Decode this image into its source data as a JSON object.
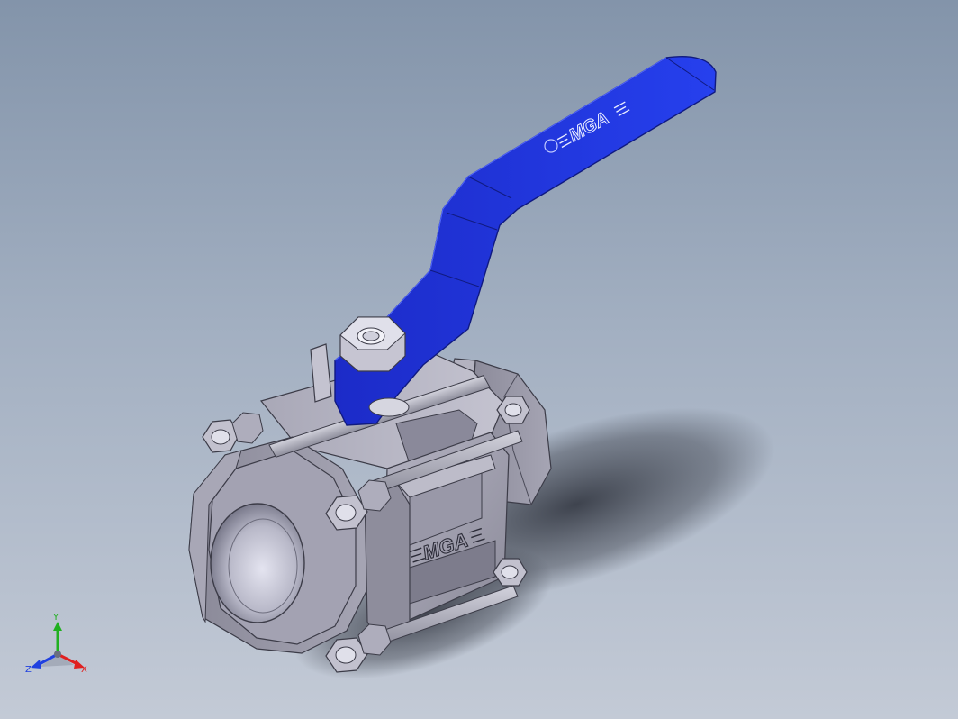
{
  "brand": {
    "handle_logo": "MGA",
    "body_logo": "MGA"
  },
  "triad": {
    "x_label": "X",
    "y_label": "Y",
    "z_label": "Z",
    "x_color": "#e02020",
    "y_color": "#20b020",
    "z_color": "#2040e0"
  },
  "colors": {
    "background_top": "#8394aa",
    "background_bottom": "#c3cad6",
    "handle": "#1a2fd6",
    "body_metal": "#9a9aa8",
    "shadow": "#3a3e48"
  }
}
